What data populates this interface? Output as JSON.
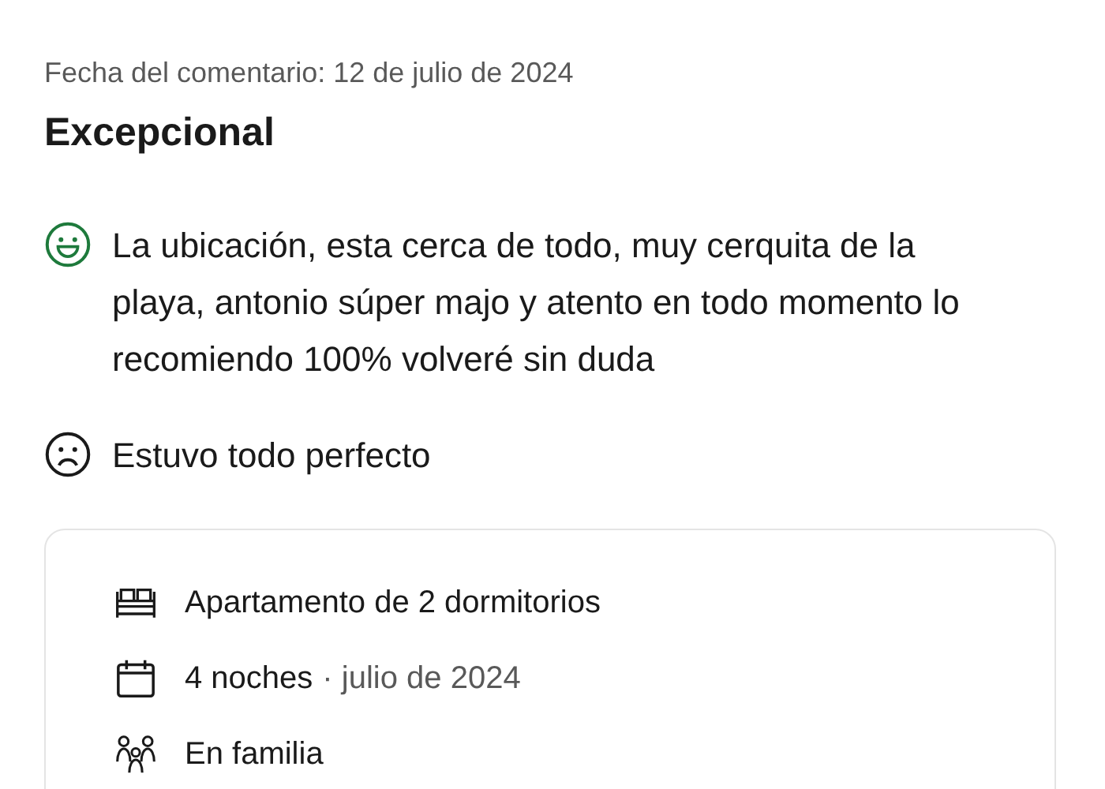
{
  "review": {
    "date": "Fecha del comentario: 12 de julio de 2024",
    "score_label": "Excepcional",
    "comments": [
      {
        "kind": "positive",
        "color": "#1e7a3c",
        "text": "La ubicación, esta cerca de todo, muy cerquita de la playa, antonio súper majo y atento en todo momento lo recomiendo 100% volveré sin duda"
      },
      {
        "kind": "negative",
        "color": "#1a1a1a",
        "text": "Estuvo todo perfecto"
      }
    ],
    "stay_details": [
      {
        "kind": "room",
        "text": "Apartamento de 2 dormitorios"
      },
      {
        "kind": "dates",
        "text": "4 noches",
        "secondary": "· julio de 2024"
      },
      {
        "kind": "group",
        "text": "En familia"
      }
    ]
  }
}
